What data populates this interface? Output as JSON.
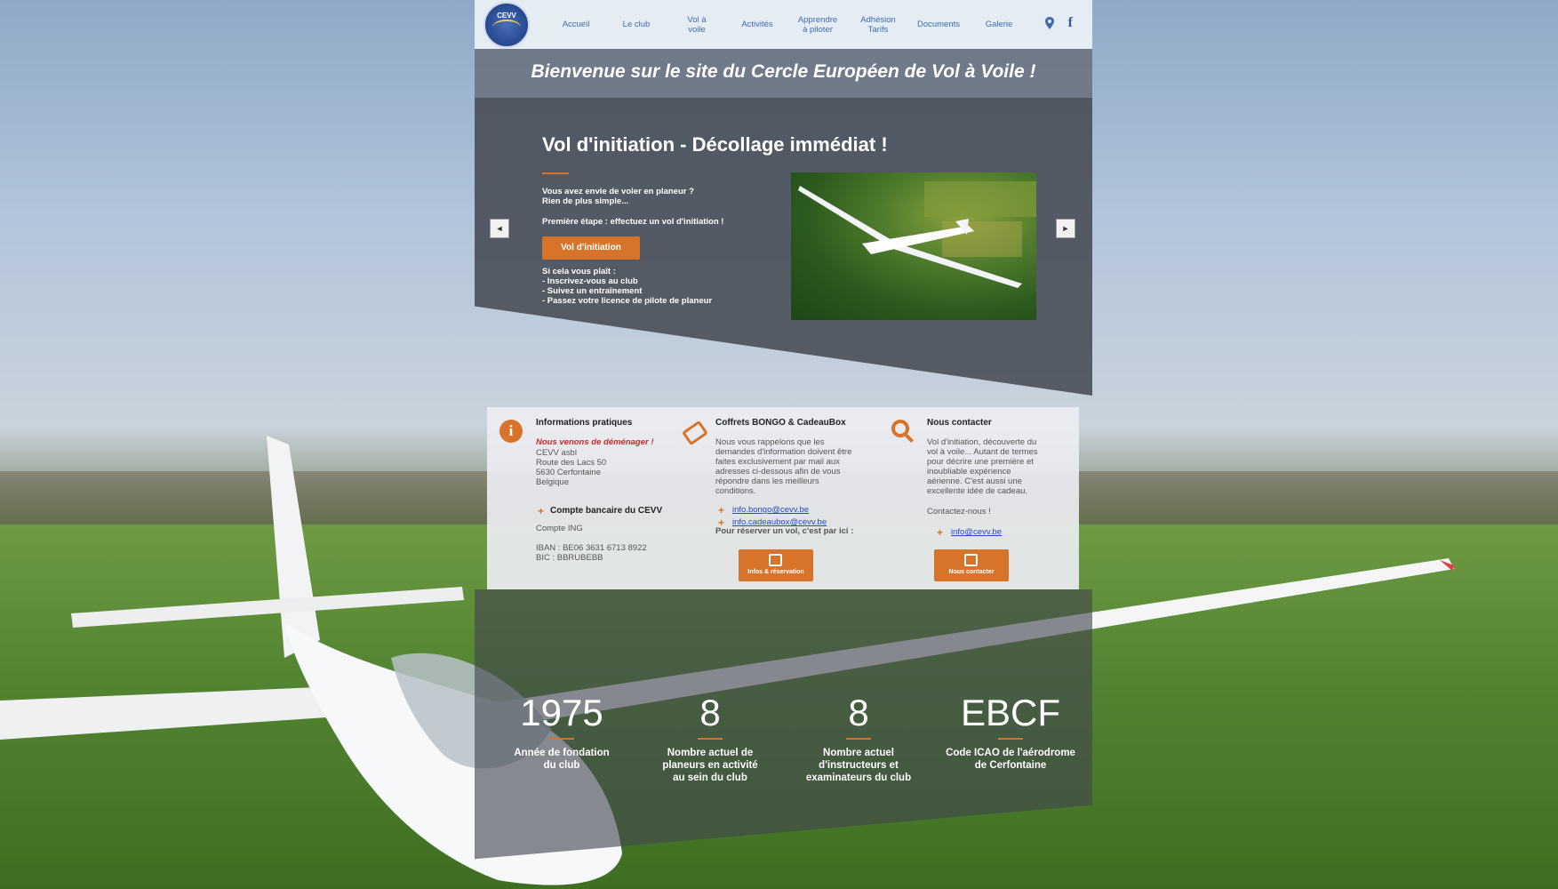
{
  "colors": {
    "accent": "#d8742a",
    "link": "#2847c9",
    "nav": "#3d6db0",
    "alert": "#d42626"
  },
  "logo": {
    "text": "CEVV"
  },
  "nav": {
    "items": [
      "Accueil",
      "Le club",
      "Vol à\nvoile",
      "Activités",
      "Apprendre\nà piloter",
      "Adhésion\nTarifs",
      "Documents",
      "Galerie"
    ],
    "icons": [
      "map-pin-icon",
      "facebook-icon"
    ],
    "facebook_glyph": "f"
  },
  "welcome": {
    "title": "Bienvenue sur le site du Cercle Européen de Vol à Voile !"
  },
  "slider": {
    "title": "Vol d'initiation - Décollage immédiat !",
    "intro": "Vous avez envie de voler en planeur ?\nRien de plus simple...",
    "step": "Première étape : effectuez un vol d'initiation !",
    "button": "Vol d'initiation",
    "then": "Si cela vous plaît :\n- Inscrivez-vous au club\n- Suivez un entraînement\n- Passez votre licence de pilote de planeur",
    "prev": "◄",
    "next": "►"
  },
  "info": {
    "practical": {
      "heading": "Informations pratiques",
      "icon": "i",
      "moved": "Nous venons de déménager !",
      "address": "CEVV asbl\nRoute des Lacs 50\n5630 Cerfontaine\nBelgique",
      "bank_heading": "Compte bancaire du CEVV",
      "bank_name": "Compte ING",
      "bank_details": "IBAN : BE06 3631 6713 8922\nBIC : BBRUBEBB"
    },
    "coffrets": {
      "heading": "Coffrets BONGO & CadeauBox",
      "text": "Nous vous rappelons que les\ndemandes d'information doivent être\nfaites exclusivement par mail aux\nadresses ci-dessous afin de vous\nrépondre dans les meilleurs\nconditions.",
      "email_bongo": "info.bongo@cevv.be",
      "email_cadeaubox": "info.cadeaubox@cevv.be",
      "reserve": "Pour réserver un vol, c'est par ici :",
      "button": "Infos & réservation"
    },
    "contact": {
      "heading": "Nous contacter",
      "text": "Vol d'initiation, découverte du\nvol à voile... Autant de termes\npour décrire une première et\ninoubliable expérience\naérienne. C'est aussi une\nexcellente idée de cadeau.",
      "cta": "Contactez-nous !",
      "email": "info@cevv.be",
      "button": "Nous contacter"
    }
  },
  "stats": [
    {
      "value": "1975",
      "label": "Année de fondation\ndu club"
    },
    {
      "value": "8",
      "label": "Nombre actuel de\nplaneurs en activité\nau sein du club"
    },
    {
      "value": "8",
      "label": "Nombre actuel\nd'instructeurs et\nexaminateurs du club"
    },
    {
      "value": "EBCF",
      "label": "Code ICAO de l'aérodrome\nde Cerfontaine"
    }
  ]
}
